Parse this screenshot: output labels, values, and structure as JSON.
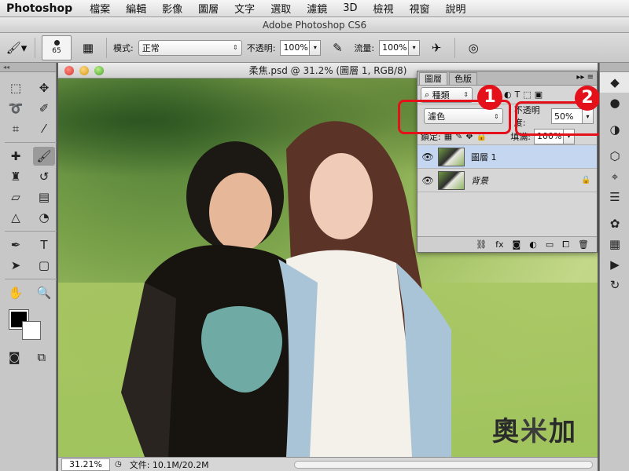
{
  "menubar": {
    "app_name": "Photoshop",
    "items": [
      "檔案",
      "編輯",
      "影像",
      "圖層",
      "文字",
      "選取",
      "濾鏡",
      "3D",
      "檢視",
      "視窗",
      "說明"
    ]
  },
  "window": {
    "title": "Adobe Photoshop CS6"
  },
  "options_bar": {
    "brush_size": "65",
    "mode_label": "模式:",
    "mode_value": "正常",
    "opacity_label": "不透明:",
    "opacity_value": "100%",
    "flow_label": "流量:",
    "flow_value": "100%"
  },
  "document": {
    "title": "柔焦.psd @ 31.2% (圖層 1, RGB/8)",
    "zoom": "31.21%",
    "doc_info": "文件: 10.1M/20.2M"
  },
  "layers_panel": {
    "tabs": [
      "圖層",
      "色版"
    ],
    "filter_kind": "種類",
    "blend_mode": "濾色",
    "opacity_label": "不透明度:",
    "opacity_value": "50%",
    "lock_label": "鎖定:",
    "fill_label": "填滿:",
    "fill_value": "100%",
    "layers": [
      {
        "name": "圖層 1",
        "selected": true,
        "locked": false
      },
      {
        "name": "背景",
        "selected": false,
        "locked": true
      }
    ]
  },
  "callouts": {
    "badge1": "1",
    "badge2": "2"
  },
  "watermark": {
    "char1": "奧",
    "char2": "米",
    "char3": "加"
  },
  "colors": {
    "highlight": "#e4101a",
    "selected_layer": "#c4d6f0",
    "foreground": "#000000",
    "background": "#ffffff"
  }
}
